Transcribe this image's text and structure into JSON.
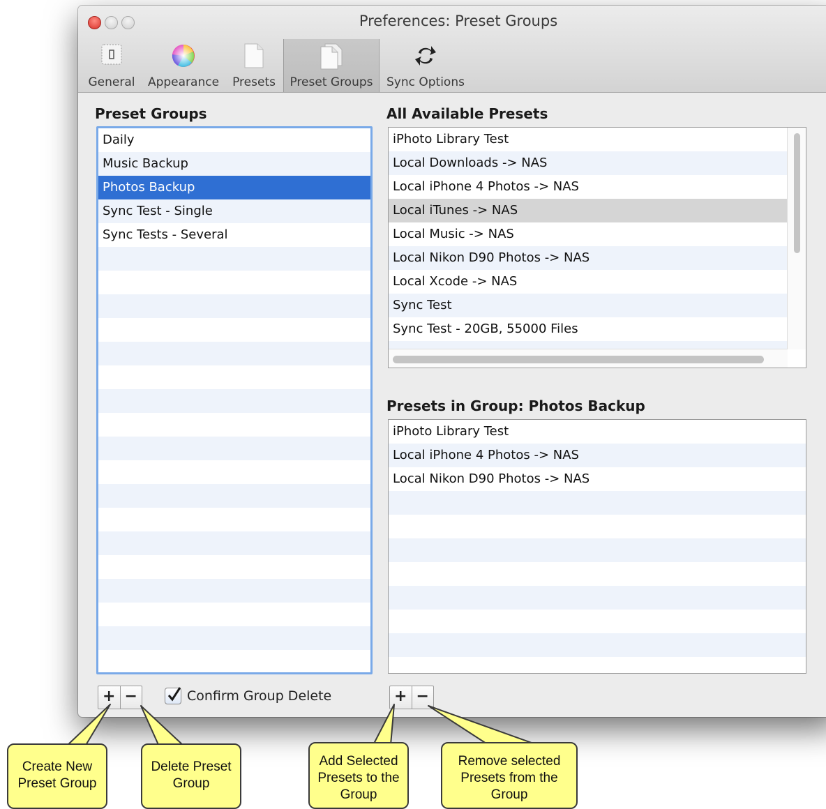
{
  "window": {
    "title": "Preferences: Preset Groups"
  },
  "toolbar": {
    "items": [
      {
        "label": "General",
        "icon": "general-icon"
      },
      {
        "label": "Appearance",
        "icon": "color-wheel-icon"
      },
      {
        "label": "Presets",
        "icon": "document-icon"
      },
      {
        "label": "Preset Groups",
        "icon": "documents-icon",
        "selected": true
      },
      {
        "label": "Sync Options",
        "icon": "sync-arrows-icon"
      }
    ]
  },
  "preset_groups": {
    "heading": "Preset Groups",
    "items": [
      "Daily",
      "Music Backup",
      "Photos Backup",
      "Sync Test - Single",
      "Sync Tests - Several"
    ],
    "selected": "Photos Backup",
    "confirm_delete_label": "Confirm Group Delete",
    "confirm_delete_checked": true
  },
  "all_presets": {
    "heading": "All Available Presets",
    "items": [
      "iPhoto Library Test",
      "Local Downloads -> NAS",
      "Local iPhone 4 Photos -> NAS",
      "Local iTunes -> NAS",
      "Local Music -> NAS",
      "Local Nikon D90 Photos -> NAS",
      "Local Xcode -> NAS",
      "Sync Test",
      "Sync Test - 20GB, 55000 Files"
    ],
    "highlighted": "Local iTunes -> NAS"
  },
  "group_presets": {
    "heading": "Presets in Group:  Photos Backup",
    "items": [
      "iPhoto Library Test",
      "Local iPhone 4 Photos -> NAS",
      "Local Nikon D90 Photos -> NAS"
    ]
  },
  "buttons": {
    "plus": "+",
    "minus": "−"
  },
  "callouts": {
    "create": "Create New Preset Group",
    "delete": "Delete Preset Group",
    "add": "Add Selected Presets to the Group",
    "remove": "Remove selected Presets from the Group"
  }
}
